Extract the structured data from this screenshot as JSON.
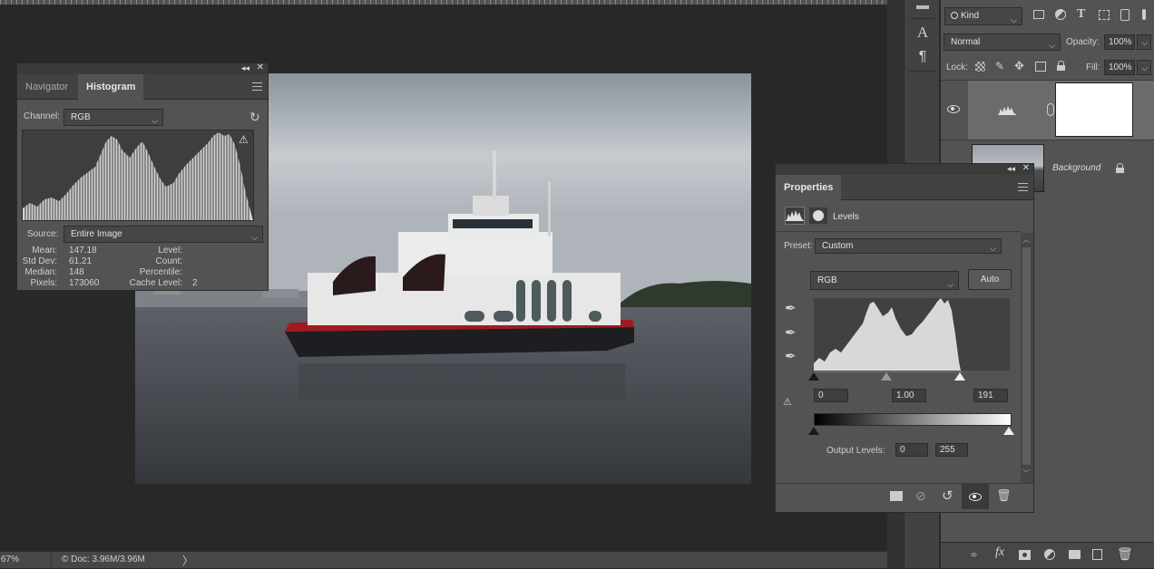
{
  "status": {
    "zoom": "67%",
    "doc": "© Doc: 3.96M/3.96M",
    "arrow": "〉"
  },
  "histogram_panel": {
    "tabs": [
      "Navigator",
      "Histogram"
    ],
    "channel_label": "Channel:",
    "channel_value": "RGB",
    "source_label": "Source:",
    "source_value": "Entire Image",
    "stats": {
      "mean_label": "Mean:",
      "mean": "147.18",
      "std_label": "Std Dev:",
      "std": "61.21",
      "median_label": "Median:",
      "median": "148",
      "pixels_label": "Pixels:",
      "pixels": "173060",
      "level_label": "Level:",
      "count_label": "Count:",
      "percentile_label": "Percentile:",
      "cache_label": "Cache Level:",
      "cache": "2"
    },
    "warning_icon": "warning-icon"
  },
  "layers_panel": {
    "filter_kind": "Kind",
    "blend_mode": "Normal",
    "opacity_label": "Opacity:",
    "opacity": "100%",
    "lock_label": "Lock:",
    "fill_label": "Fill:",
    "fill": "100%",
    "layers": [
      {
        "name": "",
        "type": "levels-adjustment"
      },
      {
        "name": "Background"
      }
    ]
  },
  "properties_panel": {
    "tab": "Properties",
    "adjustment": "Levels",
    "preset_label": "Preset:",
    "preset_value": "Custom",
    "channel_value": "RGB",
    "auto_label": "Auto",
    "input_black": "0",
    "input_gamma": "1.00",
    "input_white": "191",
    "output_label": "Output Levels:",
    "output_black": "0",
    "output_white": "255"
  },
  "colors": {
    "panel": "#535353",
    "panel_dark": "#424242",
    "canvas": "#282828",
    "accent": "#e8e8e8"
  }
}
